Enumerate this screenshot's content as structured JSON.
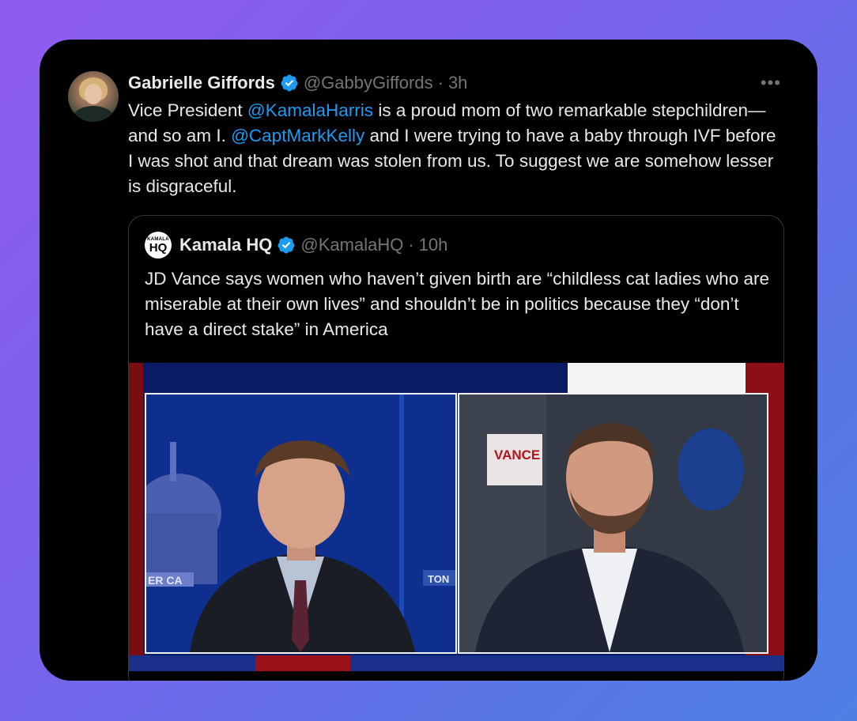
{
  "tweet": {
    "author_name": "Gabrielle Giffords",
    "handle": "@GabbyGiffords",
    "separator": "·",
    "time": "3h",
    "more_label": "•••",
    "text_parts": [
      {
        "text": "Vice President ",
        "link": false
      },
      {
        "text": "@KamalaHarris",
        "link": true
      },
      {
        "text": " is a proud mom of two remarkable stepchildren—and so am I. ",
        "link": false
      },
      {
        "text": "@CaptMarkKelly",
        "link": true
      },
      {
        "text": " and I were trying to have a baby through IVF before I was shot and that dream was stolen from us. To suggest we are somehow lesser is disgraceful.",
        "link": false
      }
    ]
  },
  "quoted": {
    "logo_line1": "KAMALA",
    "logo_line2": "HQ",
    "author_name": "Kamala HQ",
    "handle": "@KamalaHQ",
    "separator": "·",
    "time": "10h",
    "text": "JD Vance says women who haven’t given birth are “childless cat ladies who are miserable at their own lives” and shouldn’t be in politics because they “don’t have a direct stake” in America",
    "media": {
      "sign_text": "VANCE",
      "left_banner_text": "ER CA",
      "right_banner_text": "TON"
    }
  },
  "colors": {
    "accent": "#1d9bf0",
    "text": "#e7e9ea",
    "secondary": "#71767b",
    "card_bg": "#000000"
  },
  "icons": {
    "verified": "verified-badge-icon",
    "more": "more-icon"
  }
}
